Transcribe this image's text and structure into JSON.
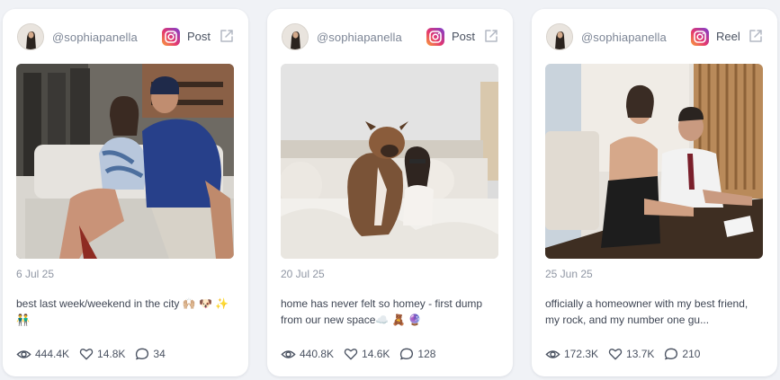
{
  "posts": [
    {
      "username": "@sophiapanella",
      "platform_icon": "instagram-icon",
      "post_type": "Post",
      "date": "6 Jul 25",
      "caption": "best last week/weekend in the city 🙌🏼 🐶 ✨ 👬",
      "views": "444.4K",
      "likes": "14.8K",
      "comments": "34"
    },
    {
      "username": "@sophiapanella",
      "platform_icon": "instagram-icon",
      "post_type": "Post",
      "date": "20 Jul 25",
      "caption": "home has never felt so homey - first dump from our new space☁️ 🧸 🔮",
      "views": "440.8K",
      "likes": "14.6K",
      "comments": "128"
    },
    {
      "username": "@sophiapanella",
      "platform_icon": "instagram-icon",
      "post_type": "Reel",
      "date": "25 Jun 25",
      "caption": "officially a homeowner with my best friend, my rock, and my number one gu...",
      "views": "172.3K",
      "likes": "13.7K",
      "comments": "210"
    }
  ],
  "colors": {
    "page_bg": "#f0f2f6",
    "card_bg": "#ffffff",
    "muted_text": "#8f96a3",
    "body_text": "#3f4654"
  }
}
